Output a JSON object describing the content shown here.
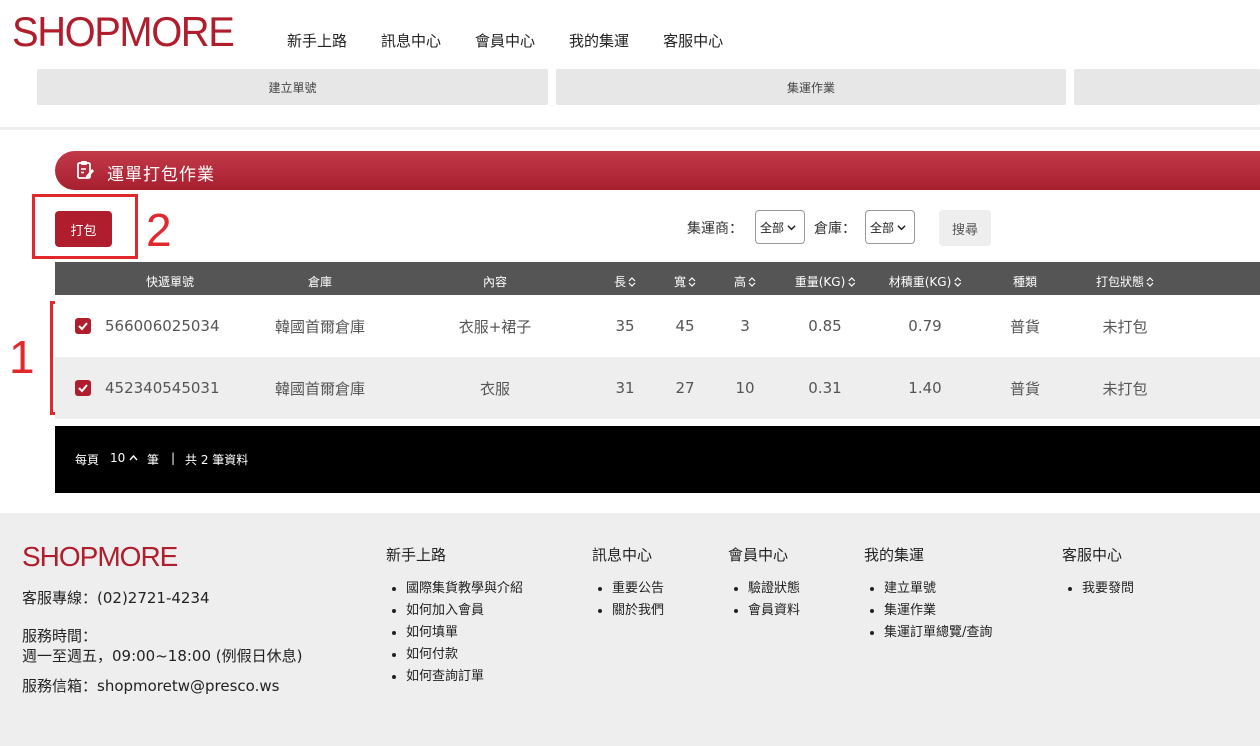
{
  "brand": {
    "logo": "SHOPMORE",
    "color": "#b01e2d"
  },
  "top_nav": [
    "新手上路",
    "訊息中心",
    "會員中心",
    "我的集運",
    "客服中心"
  ],
  "sub_nav": [
    "建立單號",
    "集運作業"
  ],
  "section": {
    "title": "運單打包作業",
    "icon": "clipboard-edit-icon"
  },
  "actions": {
    "pack_label": "打包",
    "search_label": "搜尋"
  },
  "filters": {
    "carrier_label": "集運商：",
    "carrier_value": "全部",
    "warehouse_label": "倉庫：",
    "warehouse_value": "全部"
  },
  "annotations": {
    "one": "1",
    "two": "2"
  },
  "table": {
    "headers": [
      "快遞單號",
      "倉庫",
      "內容",
      "長",
      "寬",
      "高",
      "重量(KG)",
      "材積重(KG)",
      "種類",
      "打包狀態"
    ],
    "rows": [
      {
        "checked": true,
        "tracking": "566006025034",
        "warehouse": "韓國首爾倉庫",
        "content": "衣服+裙子",
        "length": "35",
        "width": "45",
        "height": "3",
        "weight": "0.85",
        "vol_weight": "0.79",
        "type": "普貨",
        "status": "未打包"
      },
      {
        "checked": true,
        "tracking": "452340545031",
        "warehouse": "韓國首爾倉庫",
        "content": "衣服",
        "length": "31",
        "width": "27",
        "height": "10",
        "weight": "0.31",
        "vol_weight": "1.40",
        "type": "普貨",
        "status": "未打包"
      }
    ]
  },
  "pager": {
    "per_page_label": "每頁",
    "per_page_value": "10",
    "unit": "筆",
    "separator": "|",
    "total": "共 2 筆資料"
  },
  "footer": {
    "logo": "SHOPMORE",
    "hotline": "客服專線：(02)2721-4234",
    "hours_label": "服務時間：",
    "hours": "週一至週五，09:00~18:00 (例假日休息)",
    "email": "服務信箱：shopmoretw@presco.ws",
    "columns": [
      {
        "title": "新手上路",
        "items": [
          "國際集貨教學與介紹",
          "如何加入會員",
          "如何填單",
          "如何付款",
          "如何查詢訂單"
        ]
      },
      {
        "title": "訊息中心",
        "items": [
          "重要公告",
          "關於我們"
        ]
      },
      {
        "title": "會員中心",
        "items": [
          "驗證狀態",
          "會員資料"
        ]
      },
      {
        "title": "我的集運",
        "items": [
          "建立單號",
          "集運作業",
          "集運訂單總覽/查詢"
        ]
      },
      {
        "title": "客服中心",
        "items": [
          "我要發問"
        ]
      }
    ]
  }
}
